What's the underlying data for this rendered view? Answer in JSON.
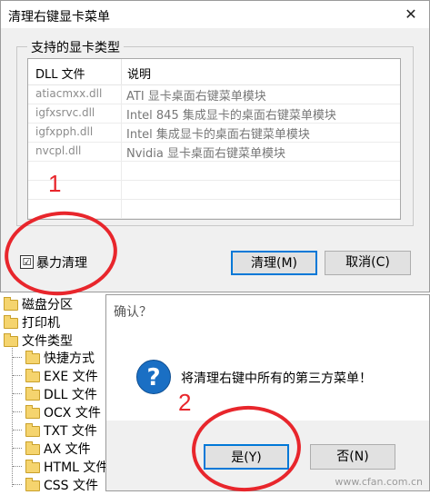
{
  "main_dialog": {
    "title": "清理右键显卡菜单",
    "close_glyph": "✕",
    "group_title": "支持的显卡类型",
    "columns": {
      "dll": "DLL 文件",
      "desc": "说明"
    },
    "rows": [
      {
        "dll": "atiacmxx.dll",
        "desc": "ATI 显卡桌面右键菜单模块"
      },
      {
        "dll": "igfxsrvc.dll",
        "desc": "Intel 845 集成显卡的桌面右键菜单模块"
      },
      {
        "dll": "igfxpph.dll",
        "desc": "Intel 集成显卡的桌面右键菜单模块"
      },
      {
        "dll": "nvcpl.dll",
        "desc": "Nvidia 显卡桌面右键菜单模块"
      }
    ],
    "force_clean_label": "暴力清理",
    "force_clean_checked": "☑",
    "clean_label": "清理(M)",
    "cancel_label": "取消(C)"
  },
  "tree": {
    "items": [
      "磁盘分区",
      "打印机",
      "文件类型",
      "快捷方式",
      "EXE 文件",
      "DLL 文件",
      "OCX 文件",
      "TXT 文件",
      "AX 文件",
      "HTML 文件",
      "CSS 文件"
    ]
  },
  "confirm_dialog": {
    "title": "确认？",
    "icon_glyph": "?",
    "message": "将清理右键中所有的第三方菜单！",
    "yes_label": "是(Y)",
    "no_label": "否(N)"
  },
  "annotations": {
    "num1": "1",
    "num2": "2"
  },
  "watermark": "www.cfan.com.cn",
  "colors": {
    "annotation": "#e8262c",
    "focus": "#0078d7",
    "icon": "#1a6fc4"
  }
}
